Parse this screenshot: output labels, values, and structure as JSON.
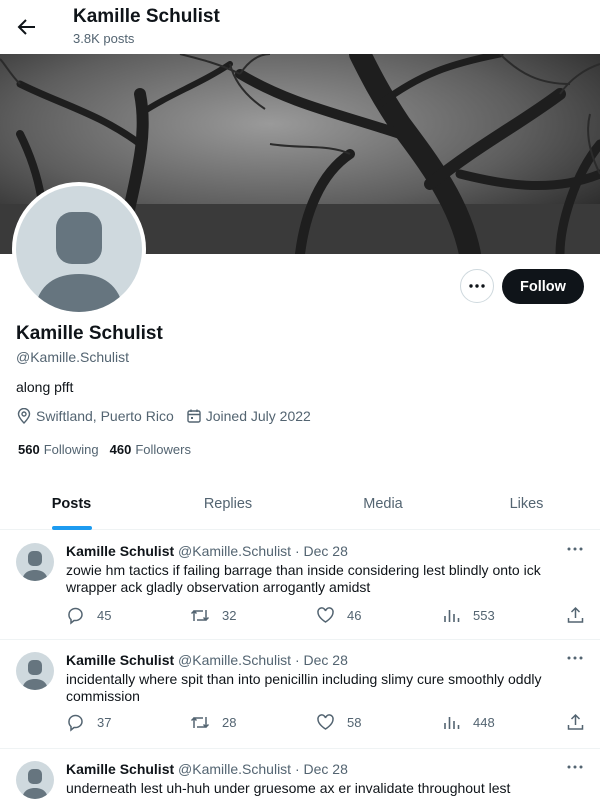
{
  "header": {
    "title": "Kamille Schulist",
    "posts_count": "3.8K posts"
  },
  "profile": {
    "name": "Kamille Schulist",
    "handle": "@Kamille.Schulist",
    "bio": "along pfft",
    "location": "Swiftland, Puerto Rico",
    "joined": "Joined July 2022",
    "following_count": "560",
    "following_label": "Following",
    "followers_count": "460",
    "followers_label": "Followers",
    "follow_label": "Follow"
  },
  "tabs": [
    {
      "label": "Posts",
      "active": true
    },
    {
      "label": "Replies",
      "active": false
    },
    {
      "label": "Media",
      "active": false
    },
    {
      "label": "Likes",
      "active": false
    }
  ],
  "posts": [
    {
      "name": "Kamille Schulist",
      "handle": "@Kamille.Schulist",
      "date": "· Dec 28",
      "text": "zowie hm tactics if failing barrage than inside considering lest blindly onto ick wrapper ack gladly observation arrogantly amidst",
      "replies": "45",
      "reposts": "32",
      "likes": "46",
      "views": "553"
    },
    {
      "name": "Kamille Schulist",
      "handle": "@Kamille.Schulist",
      "date": "· Dec 28",
      "text": "incidentally where spit than into penicillin including slimy cure smoothly oddly commission",
      "replies": "37",
      "reposts": "28",
      "likes": "58",
      "views": "448"
    },
    {
      "name": "Kamille Schulist",
      "handle": "@Kamille.Schulist",
      "date": "· Dec 28",
      "text": "underneath lest uh-huh under gruesome ax er invalidate throughout lest",
      "replies": "",
      "reposts": "",
      "likes": "",
      "views": ""
    }
  ],
  "colors": {
    "accent": "#1d9bf0",
    "text": "#0f1419",
    "muted": "#536471",
    "border": "#eff3f4",
    "avatar_bg": "#cfd9de",
    "avatar_fg": "#66757f"
  },
  "icons": [
    "back-arrow-icon",
    "more-icon",
    "location-icon",
    "calendar-icon",
    "reply-icon",
    "repost-icon",
    "like-icon",
    "views-icon",
    "share-icon"
  ]
}
